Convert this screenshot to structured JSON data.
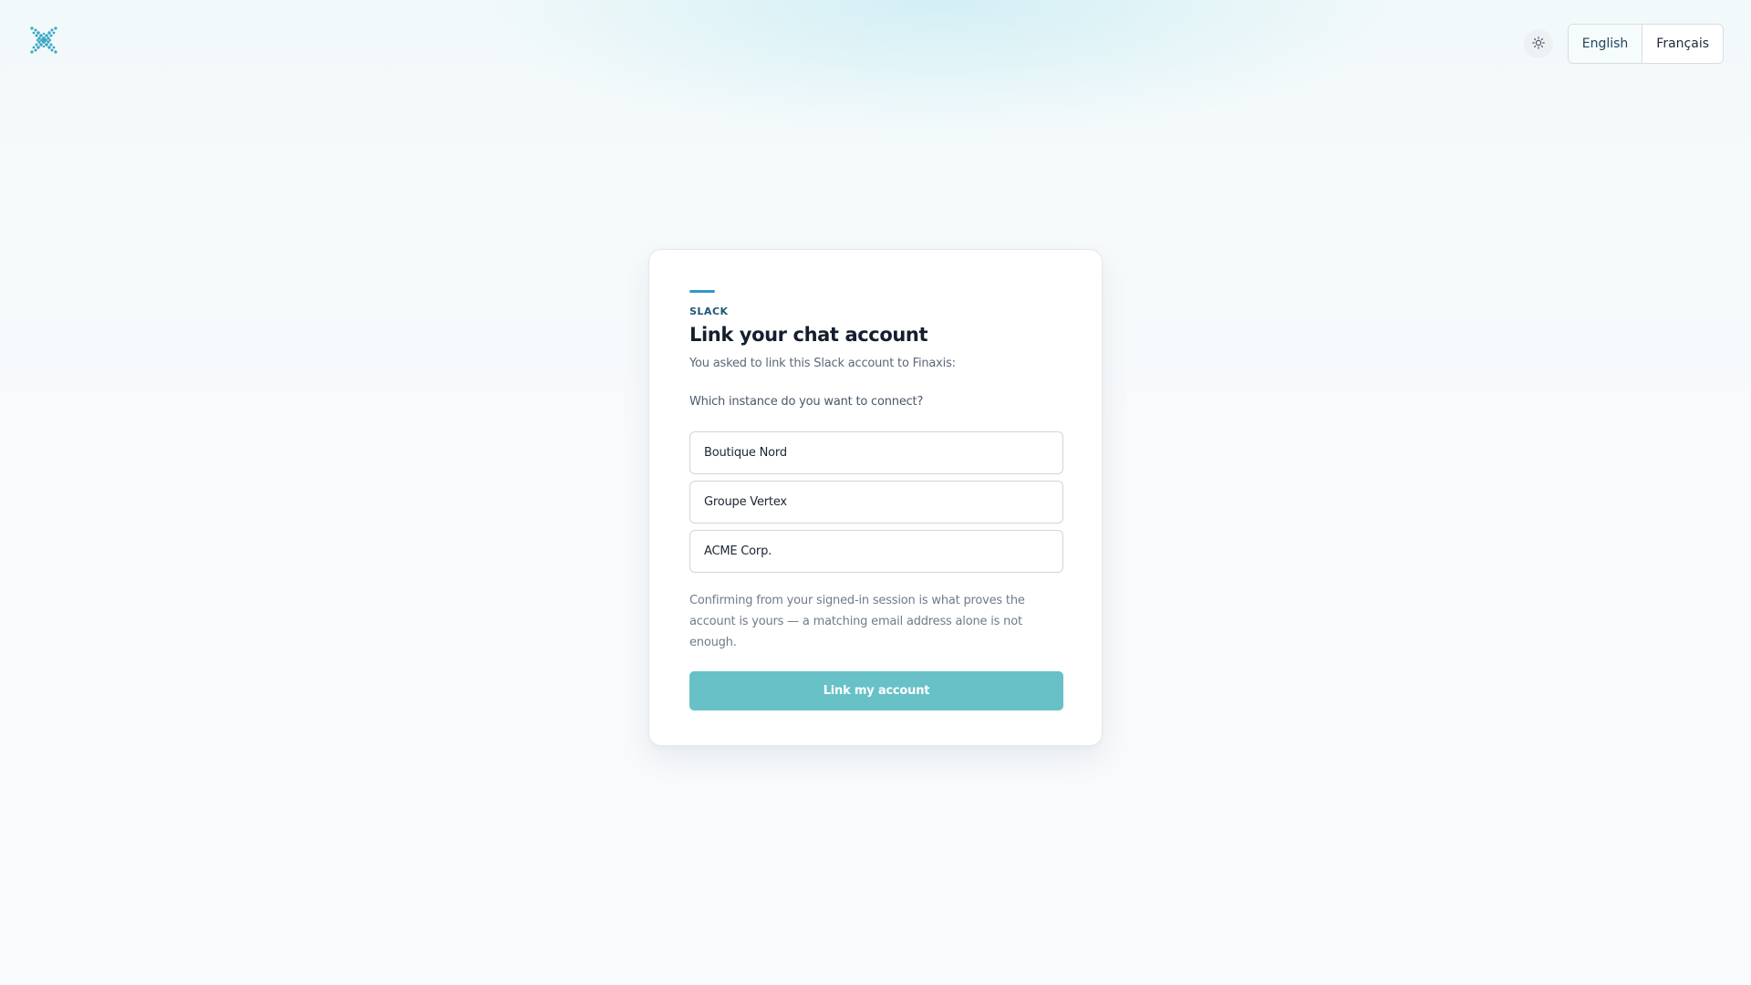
{
  "header": {
    "logo_icon": "finaxis-logo-icon",
    "theme_toggle_icon": "sun-icon",
    "languages": [
      {
        "label": "English",
        "active": true
      },
      {
        "label": "Français",
        "active": false
      }
    ]
  },
  "card": {
    "eyebrow": "SLACK",
    "title": "Link your chat account",
    "subtitle": "You asked to link this Slack account to Finaxis:",
    "question": "Which instance do you want to connect?",
    "options": [
      {
        "label": "Boutique Nord"
      },
      {
        "label": "Groupe Vertex"
      },
      {
        "label": "ACME Corp."
      }
    ],
    "note": "Confirming from your signed-in session is what proves the account is yours — a matching email address alone is not enough.",
    "submit_label": "Link my account"
  },
  "colors": {
    "accent": "#2f9ac4",
    "button": "#67c1c7",
    "heading": "#141f2e"
  }
}
